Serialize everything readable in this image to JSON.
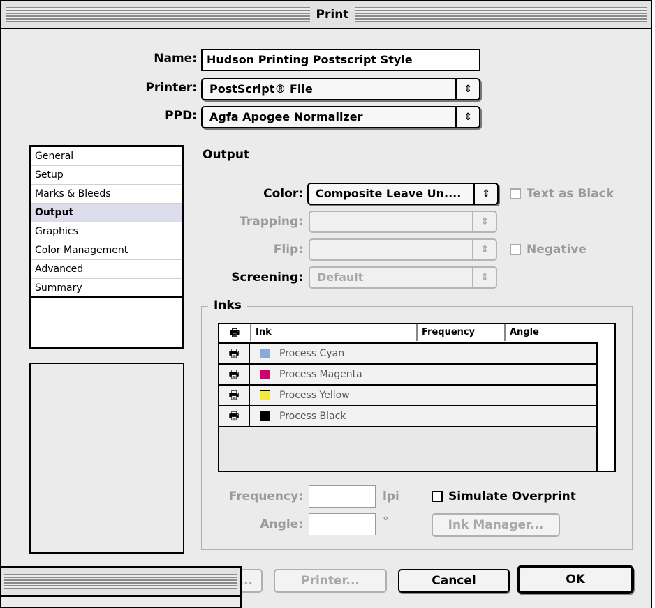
{
  "window": {
    "title": "Print"
  },
  "fields": {
    "name_label": "Name:",
    "name_value": "Hudson Printing Postscript Style",
    "printer_label": "Printer:",
    "printer_value": "PostScript® File",
    "ppd_label": "PPD:",
    "ppd_value": "Agfa Apogee Normalizer"
  },
  "sidebar": {
    "items": [
      {
        "label": "General"
      },
      {
        "label": "Setup"
      },
      {
        "label": "Marks & Bleeds"
      },
      {
        "label": "Output",
        "selected": true
      },
      {
        "label": "Graphics"
      },
      {
        "label": "Color Management"
      },
      {
        "label": "Advanced"
      },
      {
        "label": "Summary"
      }
    ]
  },
  "output": {
    "section_title": "Output",
    "color_label": "Color:",
    "color_value": "Composite Leave Un....",
    "text_as_black_label": "Text as Black",
    "trapping_label": "Trapping:",
    "trapping_value": "",
    "flip_label": "Flip:",
    "flip_value": "",
    "negative_label": "Negative",
    "screening_label": "Screening:",
    "screening_value": "Default"
  },
  "inks": {
    "group_title": "Inks",
    "columns": [
      "Ink",
      "Frequency",
      "Angle"
    ],
    "rows": [
      {
        "name": "Process Cyan",
        "color": "#8aa8d8"
      },
      {
        "name": "Process Magenta",
        "color": "#d0006f"
      },
      {
        "name": "Process Yellow",
        "color": "#f4ea3a"
      },
      {
        "name": "Process Black",
        "color": "#000000"
      }
    ],
    "frequency_label": "Frequency:",
    "frequency_unit": "lpi",
    "angle_label": "Angle:",
    "angle_unit": "°",
    "simulate_overprint_label": "Simulate Overprint",
    "ink_manager_label": "Ink Manager..."
  },
  "buttons": {
    "page_setup_label": "...",
    "printer_label": "Printer...",
    "cancel_label": "Cancel",
    "ok_label": "OK"
  }
}
